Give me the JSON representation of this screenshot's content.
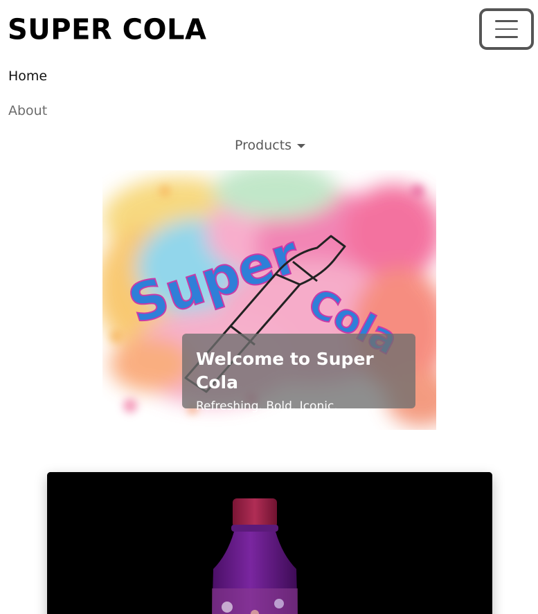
{
  "brand": {
    "name": "Super Cola"
  },
  "nav": {
    "home": "Home",
    "about": "About",
    "products": "Products"
  },
  "hero": {
    "title": "Welcome to Super Cola",
    "subtitle": "Refreshing. Bold. Iconic.",
    "image_word_1": "Super",
    "image_word_2": "Cola"
  },
  "icons": {
    "toggler": "hamburger-menu-icon",
    "dropdown": "caret-down-icon"
  },
  "colors": {
    "caption_bg": "#6e6e6e",
    "card_bg": "#000000",
    "bottle_cap": "#9b2347",
    "bottle_body": "#6a1b8c",
    "splash_word": "#2f7fd8"
  }
}
